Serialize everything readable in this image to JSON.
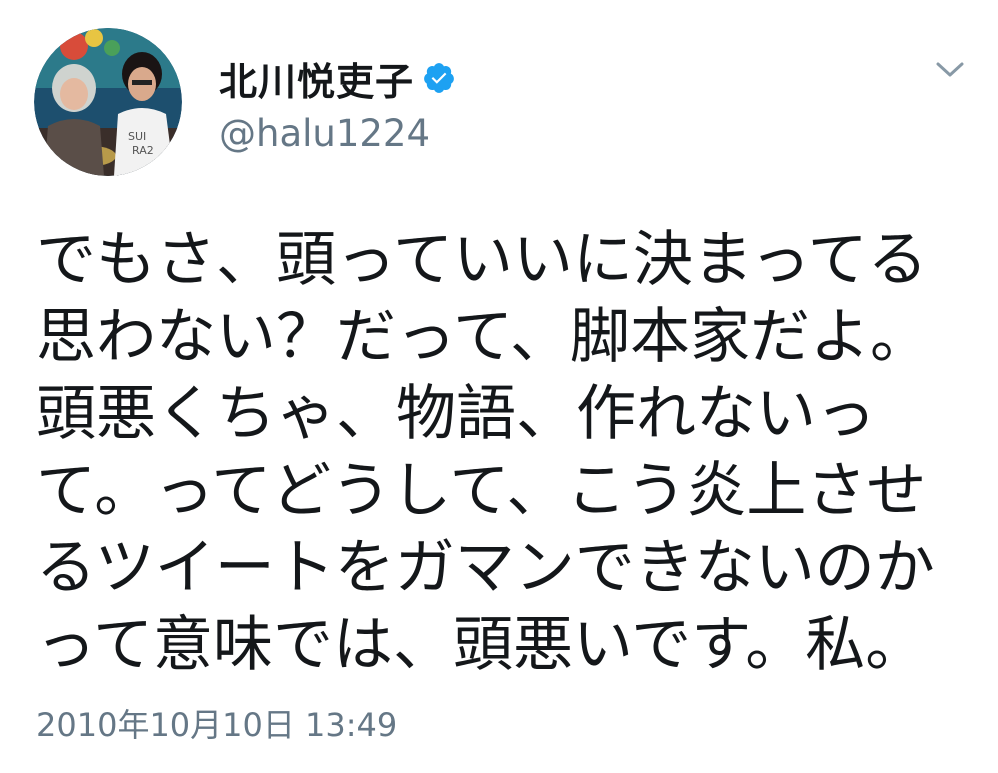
{
  "user": {
    "display_name": "北川悦吏子",
    "handle": "@halu1224",
    "verified": true
  },
  "tweet": {
    "lines": [
      "でもさ、頭っていいに決まってる",
      "思わない？だって、脚本家だよ。",
      "頭悪くちゃ、物語、作れないっ",
      "て。ってどうして、こう炎上させ",
      "るツイートをガマンできないのか",
      "って意味では、頭悪いです。私。"
    ],
    "timestamp": "2010年10月10日 13:49"
  },
  "icons": {
    "verified": "verified-badge-icon",
    "menu": "chevron-down-icon"
  },
  "colors": {
    "text": "#14171a",
    "secondary": "#657786",
    "verified_blue": "#1da1f2"
  }
}
